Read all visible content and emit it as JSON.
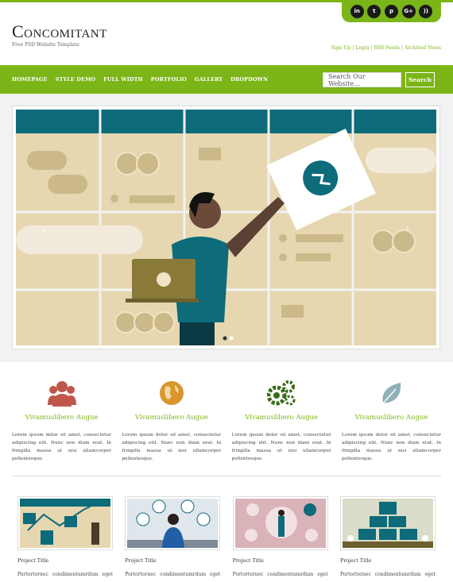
{
  "brand": {
    "title": "Concomitant",
    "tagline": "Free PSD Website Template"
  },
  "social": [
    {
      "icon": "linkedin-icon",
      "glyph": "in"
    },
    {
      "icon": "twitter-icon",
      "glyph": "t"
    },
    {
      "icon": "pinterest-icon",
      "glyph": "p"
    },
    {
      "icon": "google-plus-icon",
      "glyph": "G+"
    },
    {
      "icon": "rss-icon",
      "glyph": "))"
    }
  ],
  "toplinks": [
    "Sign Up",
    "Login",
    "RSS Feeds",
    "Archived News"
  ],
  "nav": [
    "HOMEPAGE",
    "STYLE DEMO",
    "FULL WIDTH",
    "PORTFOLIO",
    "GALLERY",
    "DROPDOWN"
  ],
  "search": {
    "placeholder": "Search Our Website...",
    "button": "Search"
  },
  "colors": {
    "accent": "#7cb518",
    "teal": "#0d6b7a",
    "beige": "#e6d7b0"
  },
  "features": [
    {
      "icon": "users-icon",
      "title": "Vivamuslibero Augue",
      "text": "Lorem ipsum dolor sit amet, consectetur adipiscing elit. Nunc non diam erat. In fringilla massa ut nisi ullamcorper pellentesque."
    },
    {
      "icon": "globe-icon",
      "title": "Vivamuslibero Augue",
      "text": "Lorem ipsum dolor sit amet, consectetur adipiscing elit. Nunc non diam erat. In fringilla massa ut nisi ullamcorper pellentesque."
    },
    {
      "icon": "gears-icon",
      "title": "Vivamuslibero Augue",
      "text": "Lorem ipsum dolor sit amet, consectetur adipiscing elit. Nunc non diam erat. In fringilla massa ut nisi ullamcorper pellentesque."
    },
    {
      "icon": "leaf-icon",
      "title": "Vivamuslibero Augue",
      "text": "Lorem ipsum dolor sit amet, consectetur adipiscing elit. Nunc non diam erat. In fringilla massa ut nisi ullamcorper pellentesque."
    }
  ],
  "projects": [
    {
      "title": "Project Title",
      "text": "Portortornec condimentumrdum eget"
    },
    {
      "title": "Project Title",
      "text": "Portortornec condimentumrdum eget"
    },
    {
      "title": "Project Title",
      "text": "Portortornec condimentumrdum eget"
    },
    {
      "title": "Project Title",
      "text": "Portortornec condimentumrdum eget"
    }
  ]
}
